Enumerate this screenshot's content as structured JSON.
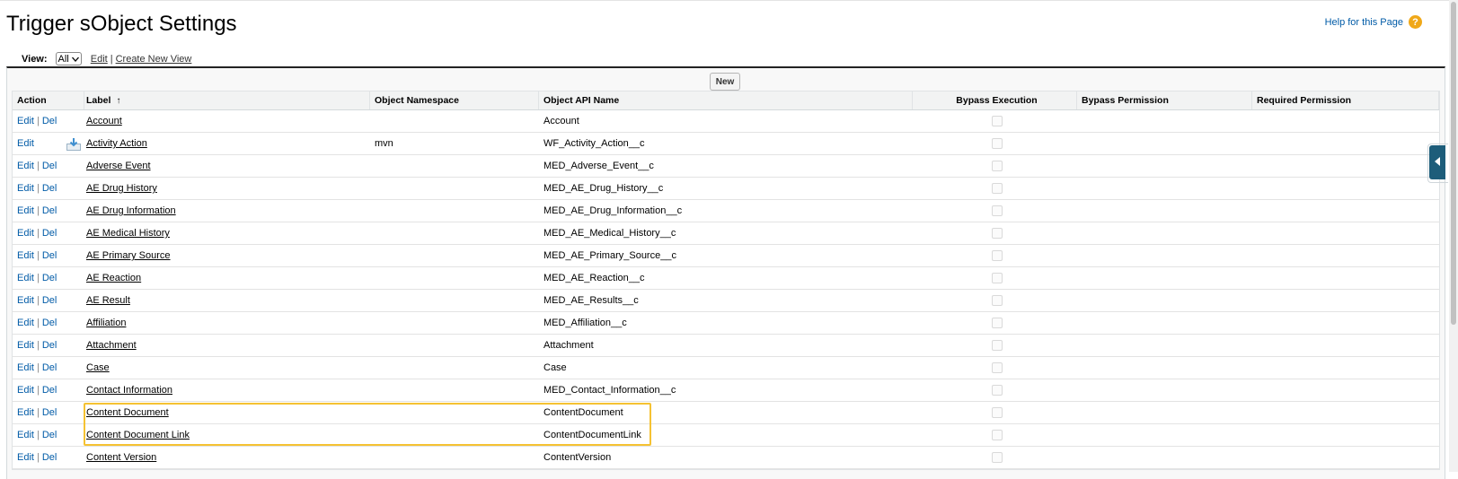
{
  "page": {
    "title": "Trigger sObject Settings",
    "help_label": "Help for this Page",
    "help_icon": "?"
  },
  "view": {
    "label": "View:",
    "selected": "All",
    "edit_label": "Edit",
    "separator": "|",
    "create_label": "Create New View"
  },
  "toolbar": {
    "new_label": "New"
  },
  "table": {
    "headers": {
      "action": "Action",
      "label": "Label",
      "sort_icon": "↑",
      "namespace": "Object Namespace",
      "api_name": "Object API Name",
      "bypass_execution": "Bypass Execution",
      "bypass_permission": "Bypass Permission",
      "required_permission": "Required Permission"
    },
    "action_links": {
      "edit": "Edit",
      "del": "Del",
      "pipe": "|"
    },
    "rows": [
      {
        "label": "Account",
        "namespace": "",
        "api_name": "Account",
        "has_del": true
      },
      {
        "label": "Activity Action",
        "namespace": "mvn",
        "api_name": "WF_Activity_Action__c",
        "has_del": false
      },
      {
        "label": "Adverse Event",
        "namespace": "",
        "api_name": "MED_Adverse_Event__c",
        "has_del": true
      },
      {
        "label": "AE Drug History",
        "namespace": "",
        "api_name": "MED_AE_Drug_History__c",
        "has_del": true
      },
      {
        "label": "AE Drug Information",
        "namespace": "",
        "api_name": "MED_AE_Drug_Information__c",
        "has_del": true
      },
      {
        "label": "AE Medical History",
        "namespace": "",
        "api_name": "MED_AE_Medical_History__c",
        "has_del": true
      },
      {
        "label": "AE Primary Source",
        "namespace": "",
        "api_name": "MED_AE_Primary_Source__c",
        "has_del": true
      },
      {
        "label": "AE Reaction",
        "namespace": "",
        "api_name": "MED_AE_Reaction__c",
        "has_del": true
      },
      {
        "label": "AE Result",
        "namespace": "",
        "api_name": "MED_AE_Results__c",
        "has_del": true
      },
      {
        "label": "Affiliation",
        "namespace": "",
        "api_name": "MED_Affiliation__c",
        "has_del": true
      },
      {
        "label": "Attachment",
        "namespace": "",
        "api_name": "Attachment",
        "has_del": true
      },
      {
        "label": "Case",
        "namespace": "",
        "api_name": "Case",
        "has_del": true
      },
      {
        "label": "Contact Information",
        "namespace": "",
        "api_name": "MED_Contact_Information__c",
        "has_del": true
      },
      {
        "label": "Content Document",
        "namespace": "",
        "api_name": "ContentDocument",
        "has_del": true
      },
      {
        "label": "Content Document Link",
        "namespace": "",
        "api_name": "ContentDocumentLink",
        "has_del": true
      },
      {
        "label": "Content Version",
        "namespace": "",
        "api_name": "ContentVersion",
        "has_del": true
      }
    ]
  },
  "colors": {
    "link_blue": "#015ba7",
    "highlight": "#f5c232",
    "side_tab": "#1d5d7a",
    "help_icon": "#f0a818"
  }
}
